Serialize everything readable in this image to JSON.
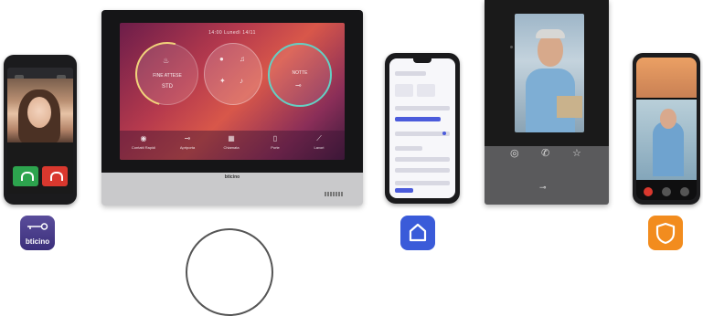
{
  "monitor": {
    "brand": "bticino",
    "screen_title": "14:00  Lunedì  14/11",
    "circles": [
      {
        "label": "FINE ATTESE",
        "sub": "STD"
      },
      {
        "label": "",
        "sub": ""
      },
      {
        "label": "NOTTE",
        "sub": ""
      }
    ],
    "tiles": [
      "Contatti Rapidi",
      "Apriporta",
      "Chiamata",
      "Porte",
      "Lavori"
    ]
  },
  "apps": {
    "bticino_label": "bticino"
  },
  "colors": {
    "home_app": "#3a5bd9",
    "shield_app": "#f28c1e",
    "bticino_app": "#4b3f8b",
    "call_accept": "#2da44e",
    "call_reject": "#d9382e"
  },
  "icons": [
    "key-icon",
    "home-icon",
    "shield-icon",
    "phone-icon",
    "bell-icon",
    "star-icon"
  ]
}
